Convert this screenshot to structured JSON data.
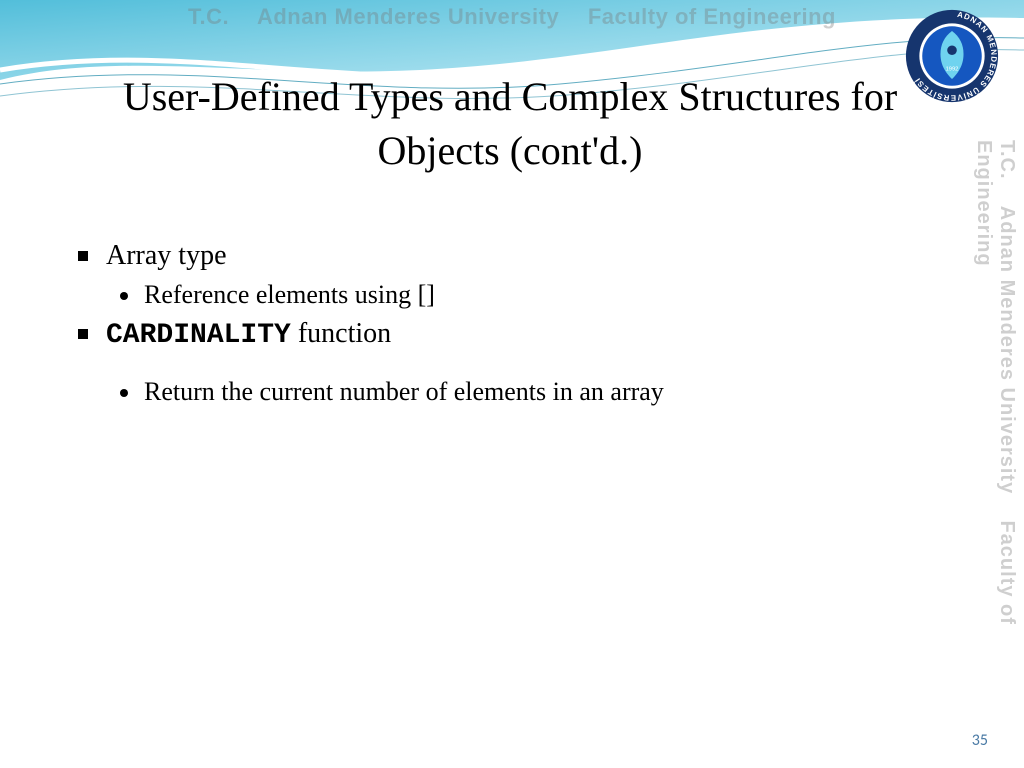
{
  "watermark": {
    "tc": "T.C.",
    "univ": "Adnan Menderes University",
    "faculty": "Faculty of Engineering"
  },
  "title": "User-Defined Types and Complex Structures for Objects (cont'd.)",
  "bullets": {
    "item1": "Array type",
    "item1_sub1": "Reference elements using []",
    "item2_code": "CARDINALITY",
    "item2_rest": " function",
    "item2_sub1": "Return the current number of elements in an array"
  },
  "pagenum": "35",
  "logo": {
    "ringText": "ADNAN MENDERES ÜNİVERSİTESİ",
    "year": "1992"
  }
}
